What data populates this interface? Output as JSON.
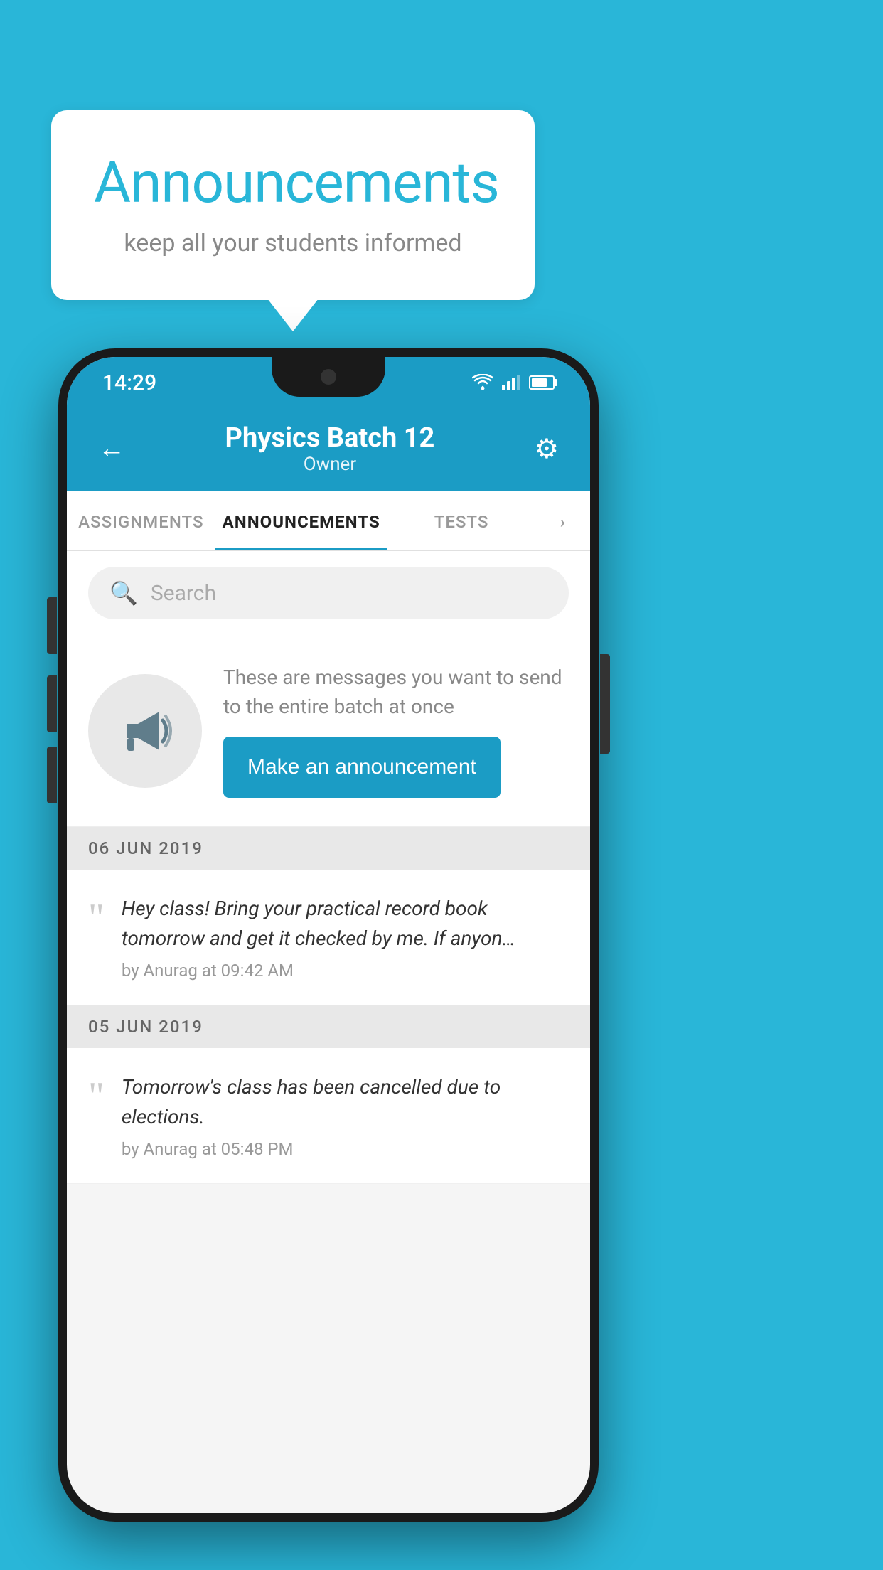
{
  "bubble": {
    "title": "Announcements",
    "subtitle": "keep all your students informed"
  },
  "phone": {
    "status_bar": {
      "time": "14:29",
      "icons": [
        "wifi",
        "signal",
        "battery"
      ]
    },
    "header": {
      "title": "Physics Batch 12",
      "subtitle": "Owner",
      "back_label": "←",
      "settings_label": "⚙"
    },
    "tabs": [
      {
        "label": "ASSIGNMENTS",
        "active": false
      },
      {
        "label": "ANNOUNCEMENTS",
        "active": true
      },
      {
        "label": "TESTS",
        "active": false
      },
      {
        "label": "›",
        "active": false
      }
    ],
    "search": {
      "placeholder": "Search"
    },
    "cta": {
      "description": "These are messages you want to send to the entire batch at once",
      "button_label": "Make an announcement"
    },
    "announcements": [
      {
        "date": "06  JUN  2019",
        "text": "Hey class! Bring your practical record book tomorrow and get it checked by me. If anyon…",
        "meta": "by Anurag at 09:42 AM"
      },
      {
        "date": "05  JUN  2019",
        "text": "Tomorrow's class has been cancelled due to elections.",
        "meta": "by Anurag at 05:48 PM"
      }
    ]
  }
}
